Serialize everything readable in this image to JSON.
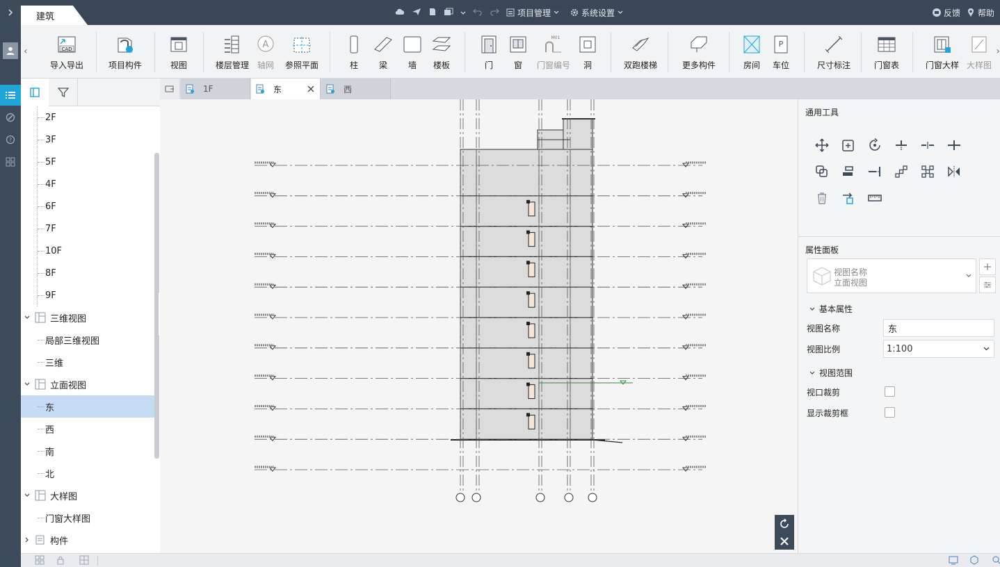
{
  "app": {
    "module_tab": "建筑",
    "top_menu": {
      "project_label": "项目管理",
      "settings_label": "系统设置",
      "feedback_label": "反馈",
      "help_label": "帮助"
    }
  },
  "ribbon": {
    "buttons": [
      {
        "label": "导入导出",
        "icon": "cad-import-icon"
      },
      {
        "label": "项目构件",
        "icon": "component-library-icon"
      },
      {
        "label": "视图",
        "icon": "view-icon"
      },
      {
        "label": "楼层管理",
        "icon": "floor-manage-icon"
      },
      {
        "label": "轴网",
        "icon": "grid-axis-icon"
      },
      {
        "label": "参照平面",
        "icon": "reference-plane-icon"
      },
      {
        "label": "柱",
        "icon": "column-icon"
      },
      {
        "label": "梁",
        "icon": "beam-icon"
      },
      {
        "label": "墙",
        "icon": "wall-icon"
      },
      {
        "label": "楼板",
        "icon": "slab-icon"
      },
      {
        "label": "门",
        "icon": "door-icon"
      },
      {
        "label": "窗",
        "icon": "window-icon"
      },
      {
        "label": "门窗编号",
        "icon": "door-window-tag-icon"
      },
      {
        "label": "洞",
        "icon": "opening-icon"
      },
      {
        "label": "双跑楼梯",
        "icon": "stair-icon"
      },
      {
        "label": "更多构件",
        "icon": "more-components-icon"
      },
      {
        "label": "房间",
        "icon": "room-icon"
      },
      {
        "label": "车位",
        "icon": "parking-icon"
      },
      {
        "label": "尺寸标注",
        "icon": "dimension-icon"
      },
      {
        "label": "门窗表",
        "icon": "door-window-table-icon"
      },
      {
        "label": "门窗大样",
        "icon": "door-window-detail-icon"
      },
      {
        "label": "大样图",
        "icon": "detail-drawing-icon"
      }
    ],
    "tag_text": "M01",
    "cad_text": "CAD"
  },
  "tree": {
    "floors": [
      "2F",
      "3F",
      "5F",
      "4F",
      "6F",
      "7F",
      "10F",
      "8F",
      "9F"
    ],
    "group_3d": "三维视图",
    "items_3d": [
      "局部三维视图",
      "三维"
    ],
    "group_elev": "立面视图",
    "items_elev": [
      "东",
      "西",
      "南",
      "北"
    ],
    "group_detail": "大样图",
    "items_detail": [
      "门窗大样图"
    ],
    "group_comp": "构件"
  },
  "tabs": [
    {
      "label": "1F"
    },
    {
      "label": "东"
    },
    {
      "label": "西"
    }
  ],
  "drawing": {
    "level_count": 11,
    "axis_count": 5
  },
  "right_panel": {
    "tools_title": "通用工具",
    "props_title": "属性面板",
    "type_name_label": "视图名称",
    "type_name_value": "立面视图",
    "basic_props": "基本属性",
    "view_name_label": "视图名称",
    "view_name_value": "东",
    "view_scale_label": "视图比例",
    "view_scale_value": "1:100",
    "view_range": "视图范围",
    "crop_label": "视口裁剪",
    "crop_frame_label": "显示裁剪框"
  },
  "colors": {
    "topbar": "#3b4656",
    "leftbar": "#3d4a5a",
    "accent": "#1ea6d9",
    "selection": "#c6dcf5"
  }
}
